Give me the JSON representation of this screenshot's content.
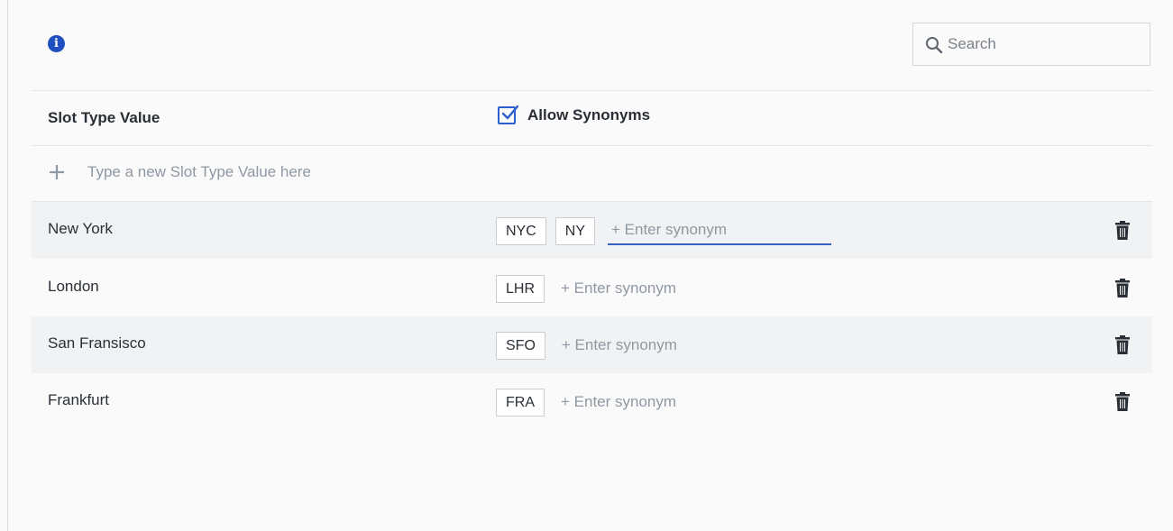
{
  "colors": {
    "accent": "#2e5fd0",
    "info_icon": "#1f4fbf",
    "row_shade": "#f1f2f3",
    "active_underline": "#3b5fc4"
  },
  "header": {
    "info_icon": "info-icon",
    "info_glyph": "i",
    "search": {
      "placeholder": "Search",
      "value": "",
      "icon": "search-icon"
    }
  },
  "table": {
    "columns": {
      "slot_type_value": "Slot Type Value",
      "allow_synonyms": "Allow Synonyms"
    },
    "allow_synonyms_checked": true,
    "new_value": {
      "icon": "plus-icon",
      "placeholder": "Type a new Slot Type Value here"
    },
    "rows": [
      {
        "name": "New York",
        "synonyms": [
          "NYC",
          "NY"
        ],
        "synonym_placeholder": "+ Enter synonym",
        "active": true
      },
      {
        "name": "London",
        "synonyms": [
          "LHR"
        ],
        "synonym_placeholder": "+ Enter synonym",
        "active": false
      },
      {
        "name": "San Fransisco",
        "synonyms": [
          "SFO"
        ],
        "synonym_placeholder": "+ Enter synonym",
        "active": false
      },
      {
        "name": "Frankfurt",
        "synonyms": [
          "FRA"
        ],
        "synonym_placeholder": "+ Enter synonym",
        "active": false
      }
    ]
  }
}
